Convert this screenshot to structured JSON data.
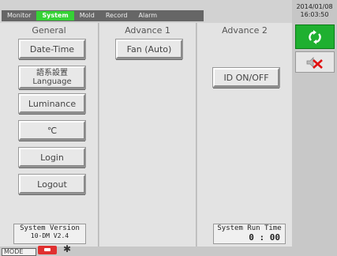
{
  "tabs": [
    {
      "label": "Monitor",
      "active": false
    },
    {
      "label": "System",
      "active": true
    },
    {
      "label": "Mold",
      "active": false
    },
    {
      "label": "Record",
      "active": false
    },
    {
      "label": "Alarm",
      "active": false
    }
  ],
  "datetime": {
    "date": "2014/01/08",
    "time": "16:03:50"
  },
  "general": {
    "title": "General",
    "buttons": {
      "date_time": "Date-Time",
      "language_line1": "語系設置",
      "language_line2": "Language",
      "luminance": "Luminance",
      "unit": "℃",
      "login": "Login",
      "logout": "Logout"
    },
    "system_version": {
      "label": "System Version",
      "value": "10-DM V2.4"
    }
  },
  "advance1": {
    "title": "Advance 1",
    "fan_button": "Fan (Auto)"
  },
  "advance2": {
    "title": "Advance 2",
    "id_button": "ID ON/OFF",
    "run_time": {
      "label": "System Run Time",
      "value": "0 : 00"
    }
  },
  "side": {
    "sync_icon": "refresh-icon",
    "mute_icon": "speaker-muted-icon"
  },
  "footer": {
    "mode_label": "MODE"
  },
  "colors": {
    "accent": "#35d135",
    "sync_bg": "#1fb030",
    "mute_x": "#e01010"
  }
}
